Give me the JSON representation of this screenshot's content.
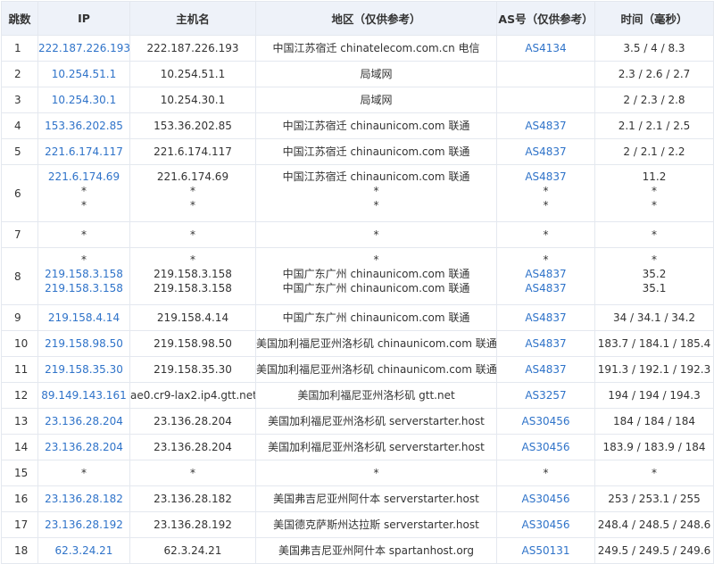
{
  "headers": [
    "跳数",
    "IP",
    "主机名",
    "地区（仅供参考）",
    "AS号（仅供参考）",
    "时间（毫秒）"
  ],
  "rows": [
    {
      "hop": "1",
      "ip": [
        "222.187.226.193"
      ],
      "host": [
        "222.187.226.193"
      ],
      "region": [
        "中国江苏宿迁 chinatelecom.com.cn 电信"
      ],
      "as": [
        "AS4134"
      ],
      "time": [
        "3.5 / 4 / 8.3"
      ]
    },
    {
      "hop": "2",
      "ip": [
        "10.254.51.1"
      ],
      "host": [
        "10.254.51.1"
      ],
      "region": [
        "局域网"
      ],
      "as": [
        ""
      ],
      "time": [
        "2.3 / 2.6 / 2.7"
      ]
    },
    {
      "hop": "3",
      "ip": [
        "10.254.30.1"
      ],
      "host": [
        "10.254.30.1"
      ],
      "region": [
        "局域网"
      ],
      "as": [
        ""
      ],
      "time": [
        "2 / 2.3 / 2.8"
      ]
    },
    {
      "hop": "4",
      "ip": [
        "153.36.202.85"
      ],
      "host": [
        "153.36.202.85"
      ],
      "region": [
        "中国江苏宿迁 chinaunicom.com 联通"
      ],
      "as": [
        "AS4837"
      ],
      "time": [
        "2.1 / 2.1 / 2.5"
      ]
    },
    {
      "hop": "5",
      "ip": [
        "221.6.174.117"
      ],
      "host": [
        "221.6.174.117"
      ],
      "region": [
        "中国江苏宿迁 chinaunicom.com 联通"
      ],
      "as": [
        "AS4837"
      ],
      "time": [
        "2 / 2.1 / 2.2"
      ]
    },
    {
      "hop": "6",
      "ip": [
        "221.6.174.69",
        "*",
        "*"
      ],
      "host": [
        "221.6.174.69",
        "*",
        "*"
      ],
      "region": [
        "中国江苏宿迁 chinaunicom.com 联通",
        "*",
        "*"
      ],
      "as": [
        "AS4837",
        "*",
        "*"
      ],
      "time": [
        "11.2",
        "*",
        "*"
      ]
    },
    {
      "hop": "7",
      "ip": [
        "*"
      ],
      "host": [
        "*"
      ],
      "region": [
        "*"
      ],
      "as": [
        "*"
      ],
      "time": [
        "*"
      ]
    },
    {
      "hop": "8",
      "ip": [
        "*",
        "219.158.3.158",
        "219.158.3.158"
      ],
      "host": [
        "*",
        "219.158.3.158",
        "219.158.3.158"
      ],
      "region": [
        "*",
        "中国广东广州 chinaunicom.com 联通",
        "中国广东广州 chinaunicom.com 联通"
      ],
      "as": [
        "*",
        "AS4837",
        "AS4837"
      ],
      "time": [
        "*",
        "35.2",
        "35.1"
      ]
    },
    {
      "hop": "9",
      "ip": [
        "219.158.4.14"
      ],
      "host": [
        "219.158.4.14"
      ],
      "region": [
        "中国广东广州 chinaunicom.com 联通"
      ],
      "as": [
        "AS4837"
      ],
      "time": [
        "34 / 34.1 / 34.2"
      ]
    },
    {
      "hop": "10",
      "ip": [
        "219.158.98.50"
      ],
      "host": [
        "219.158.98.50"
      ],
      "region": [
        "美国加利福尼亚州洛杉矶 chinaunicom.com 联通"
      ],
      "as": [
        "AS4837"
      ],
      "time": [
        "183.7 / 184.1 / 185.4"
      ]
    },
    {
      "hop": "11",
      "ip": [
        "219.158.35.30"
      ],
      "host": [
        "219.158.35.30"
      ],
      "region": [
        "美国加利福尼亚州洛杉矶 chinaunicom.com 联通"
      ],
      "as": [
        "AS4837"
      ],
      "time": [
        "191.3 / 192.1 / 192.3"
      ]
    },
    {
      "hop": "12",
      "ip": [
        "89.149.143.161"
      ],
      "host": [
        "ae0.cr9-lax2.ip4.gtt.net"
      ],
      "region": [
        "美国加利福尼亚州洛杉矶 gtt.net"
      ],
      "as": [
        "AS3257"
      ],
      "time": [
        "194 / 194 / 194.3"
      ]
    },
    {
      "hop": "13",
      "ip": [
        "23.136.28.204"
      ],
      "host": [
        "23.136.28.204"
      ],
      "region": [
        "美国加利福尼亚州洛杉矶 serverstarter.host"
      ],
      "as": [
        "AS30456"
      ],
      "time": [
        "184 / 184 / 184"
      ]
    },
    {
      "hop": "14",
      "ip": [
        "23.136.28.204"
      ],
      "host": [
        "23.136.28.204"
      ],
      "region": [
        "美国加利福尼亚州洛杉矶 serverstarter.host"
      ],
      "as": [
        "AS30456"
      ],
      "time": [
        "183.9 / 183.9 / 184"
      ]
    },
    {
      "hop": "15",
      "ip": [
        "*"
      ],
      "host": [
        "*"
      ],
      "region": [
        "*"
      ],
      "as": [
        "*"
      ],
      "time": [
        "*"
      ]
    },
    {
      "hop": "16",
      "ip": [
        "23.136.28.182"
      ],
      "host": [
        "23.136.28.182"
      ],
      "region": [
        "美国弗吉尼亚州阿什本 serverstarter.host"
      ],
      "as": [
        "AS30456"
      ],
      "time": [
        "253 / 253.1 / 255"
      ]
    },
    {
      "hop": "17",
      "ip": [
        "23.136.28.192"
      ],
      "host": [
        "23.136.28.192"
      ],
      "region": [
        "美国德克萨斯州达拉斯 serverstarter.host"
      ],
      "as": [
        "AS30456"
      ],
      "time": [
        "248.4 / 248.5 / 248.6"
      ]
    },
    {
      "hop": "18",
      "ip": [
        "62.3.24.21"
      ],
      "host": [
        "62.3.24.21"
      ],
      "region": [
        "美国弗吉尼亚州阿什本 spartanhost.org"
      ],
      "as": [
        "AS50131"
      ],
      "time": [
        "249.5 / 249.5 / 249.6"
      ]
    }
  ]
}
